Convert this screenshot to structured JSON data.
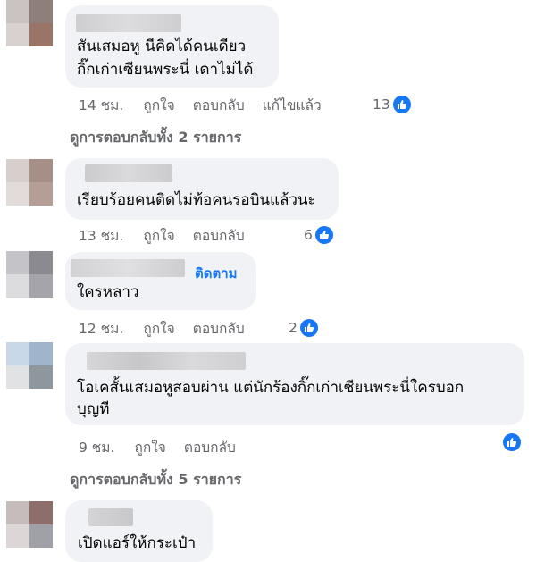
{
  "comments": [
    {
      "text_lines": [
        "สันเสมอหู นีคิดได้คนเดียว",
        "กิ๊กเก่าเซียนพระนี่ เดาไม่ได้"
      ],
      "time": "14 ชม.",
      "like": "ถูกใจ",
      "reply": "ตอบกลับ",
      "edited": "แก้ไขแล้ว",
      "reaction_count": "13",
      "reaction_icon": "like-icon",
      "view_replies": "ดูการตอบกลับทั้ง 2 รายการ"
    },
    {
      "text_lines": [
        "เรียบร้อยคนติดไม่ท้อคนรอบินแล้วนะ"
      ],
      "time": "13 ชม.",
      "like": "ถูกใจ",
      "reply": "ตอบกลับ",
      "reaction_count": "6",
      "reaction_icon": "like-icon"
    },
    {
      "follow": "ติดตาม",
      "text_lines": [
        "ใครหลาว"
      ],
      "time": "12 ชม.",
      "like": "ถูกใจ",
      "reply": "ตอบกลับ",
      "reaction_count": "2",
      "reaction_icon": "like-icon"
    },
    {
      "text_lines": [
        "โอเคสั้นเสมอหูสอบผ่าน แต่นักร้องกิ๊กเก่าเซียนพระนี่ใครบอก",
        "บุญที"
      ],
      "time": "9 ชม.",
      "like": "ถูกใจ",
      "reply": "ตอบกลับ",
      "reaction_icon": "like-icon",
      "view_replies": "ดูการตอบกลับทั้ง 5 รายการ"
    },
    {
      "text_lines": [
        "เปิดแอร์ให้กระเป๋า"
      ]
    }
  ],
  "colors": {
    "bubble": "#f0f2f5",
    "secondary_text": "#65676b",
    "link": "#1877f2",
    "like_blue": "#1877f2"
  }
}
